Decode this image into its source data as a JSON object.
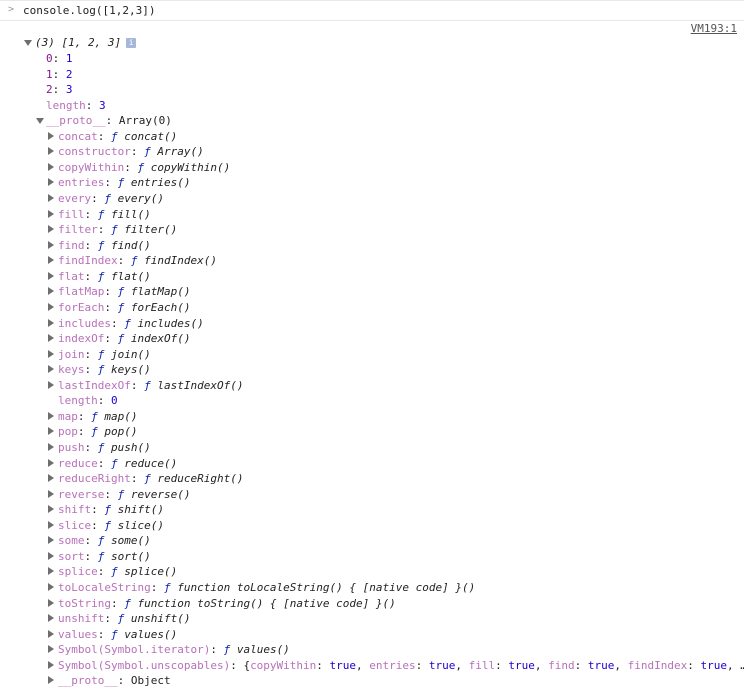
{
  "console": {
    "prompt_symbol": ">",
    "command": "console.log([1,2,3])",
    "source_link": "VM193:1"
  },
  "array_summary": {
    "count": "(3)",
    "preview": "[1, 2, 3]",
    "info_icon": "i"
  },
  "elements": [
    {
      "key": "0",
      "value": "1"
    },
    {
      "key": "1",
      "value": "2"
    },
    {
      "key": "2",
      "value": "3"
    }
  ],
  "length": {
    "key": "length",
    "value": "3"
  },
  "proto": {
    "key": "__proto__",
    "value": "Array(0)"
  },
  "methods": [
    "concat",
    "constructor",
    "copyWithin",
    "entries",
    "every",
    "fill",
    "filter",
    "find",
    "findIndex",
    "flat",
    "flatMap",
    "forEach",
    "includes",
    "indexOf",
    "join",
    "keys",
    "lastIndexOf"
  ],
  "proto_length": {
    "key": "length",
    "value": "0"
  },
  "methods2": [
    "map",
    "pop",
    "push",
    "reduce",
    "reduceRight",
    "reverse",
    "shift",
    "slice",
    "some",
    "sort",
    "splice",
    "toLocaleString",
    "toString",
    "unshift",
    "values"
  ],
  "method_value_names": {
    "constructor": "Array"
  },
  "symbol_iterator": {
    "key": "Symbol(Symbol.iterator)",
    "value_name": "values"
  },
  "symbol_unscopables": {
    "key": "Symbol(Symbol.unscopables)",
    "entries": [
      {
        "k": "copyWithin",
        "v": "true"
      },
      {
        "k": "entries",
        "v": "true"
      },
      {
        "k": "fill",
        "v": "true"
      },
      {
        "k": "find",
        "v": "true"
      },
      {
        "k": "findIndex",
        "v": "true"
      }
    ],
    "ellipsis": "…}"
  },
  "inner_proto": {
    "key": "__proto__",
    "value": "Object"
  },
  "function_symbol": "ƒ"
}
